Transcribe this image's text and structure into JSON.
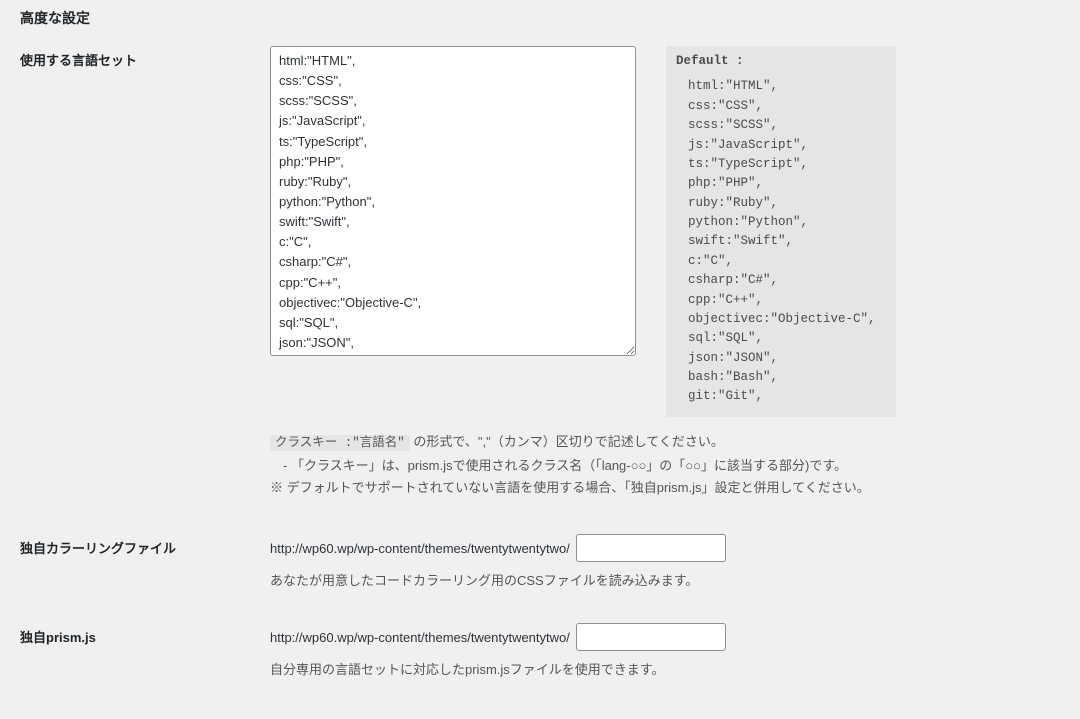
{
  "section_title": "高度な設定",
  "langset": {
    "label": "使用する言語セット",
    "textarea_value": "html:\"HTML\",\ncss:\"CSS\",\nscss:\"SCSS\",\njs:\"JavaScript\",\nts:\"TypeScript\",\nphp:\"PHP\",\nruby:\"Ruby\",\npython:\"Python\",\nswift:\"Swift\",\nc:\"C\",\ncsharp:\"C#\",\ncpp:\"C++\",\nobjectivec:\"Objective-C\",\nsql:\"SQL\",\njson:\"JSON\",\nbash:\"Bash\",",
    "default_title": "Default :",
    "default_body": "html:\"HTML\",\ncss:\"CSS\",\nscss:\"SCSS\",\njs:\"JavaScript\",\nts:\"TypeScript\",\nphp:\"PHP\",\nruby:\"Ruby\",\npython:\"Python\",\nswift:\"Swift\",\nc:\"C\",\ncsharp:\"C#\",\ncpp:\"C++\",\nobjectivec:\"Objective-C\",\nsql:\"SQL\",\njson:\"JSON\",\nbash:\"Bash\",\ngit:\"Git\",",
    "desc_code": "クラスキー :\"言語名\"",
    "desc_after_code": " の形式で、\",\"（カンマ）区切りで記述してください。",
    "desc_line2": "　-  「クラスキー」は、prism.jsで使用されるクラス名（「lang-○○」の「○○」に該当する部分)です。",
    "desc_line3": "※ デフォルトでサポートされていない言語を使用する場合、「独自prism.js」設定と併用してください。"
  },
  "coloring": {
    "label": "独自カラーリングファイル",
    "path": "http://wp60.wp/wp-content/themes/twentytwentytwo/",
    "input_value": "",
    "desc": "あなたが用意したコードカラーリング用のCSSファイルを読み込みます。"
  },
  "prismjs": {
    "label": "独自prism.js",
    "path": "http://wp60.wp/wp-content/themes/twentytwentytwo/",
    "input_value": "",
    "desc": "自分専用の言語セットに対応したprism.jsファイルを使用できます。"
  }
}
